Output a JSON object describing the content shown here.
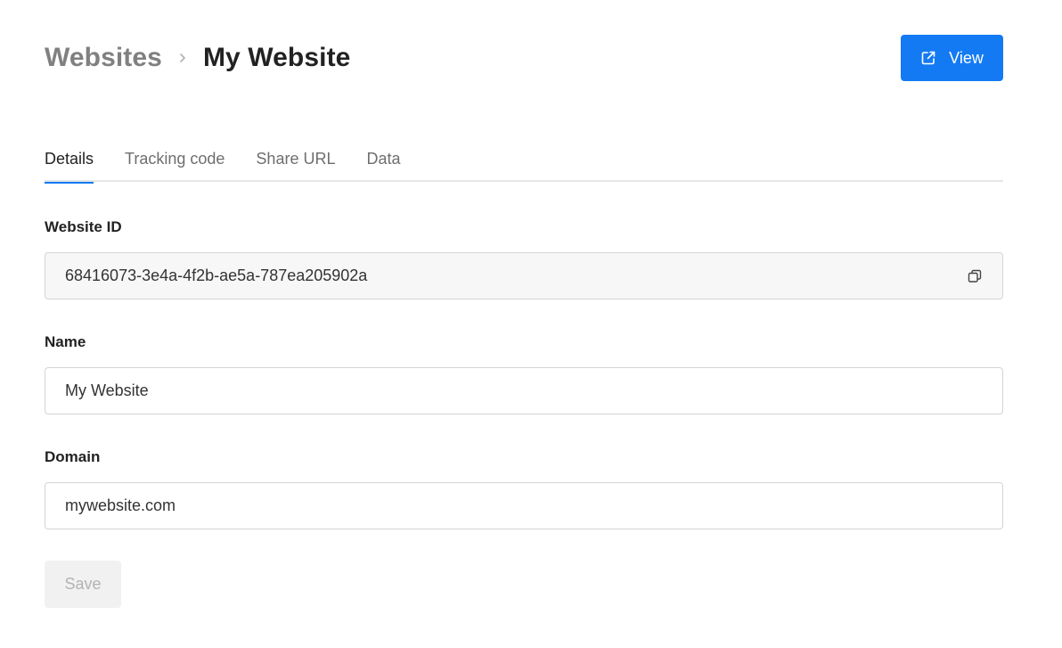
{
  "breadcrumb": {
    "parent": "Websites",
    "current": "My Website"
  },
  "header": {
    "view_label": "View"
  },
  "tabs": [
    {
      "label": "Details",
      "active": true
    },
    {
      "label": "Tracking code",
      "active": false
    },
    {
      "label": "Share URL",
      "active": false
    },
    {
      "label": "Data",
      "active": false
    }
  ],
  "form": {
    "website_id_label": "Website ID",
    "website_id_value": "68416073-3e4a-4f2b-ae5a-787ea205902a",
    "name_label": "Name",
    "name_value": "My Website",
    "domain_label": "Domain",
    "domain_value": "mywebsite.com",
    "save_label": "Save"
  },
  "colors": {
    "accent": "#147af3",
    "muted_text": "#808080",
    "disabled_bg": "#f1f1f1"
  },
  "icons": {
    "view": "external-link-icon",
    "breadcrumb_separator": "chevron-right-icon",
    "copy": "copy-icon"
  }
}
